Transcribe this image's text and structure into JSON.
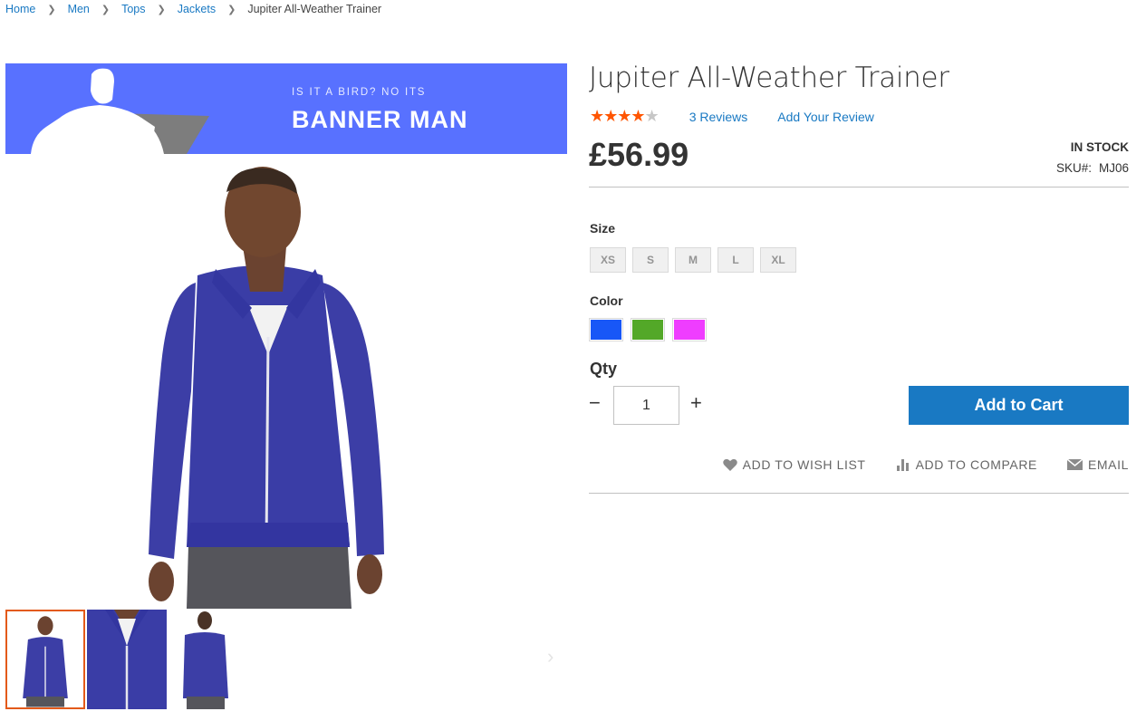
{
  "breadcrumb": {
    "items": [
      "Home",
      "Men",
      "Tops",
      "Jackets"
    ],
    "current": "Jupiter All-Weather Trainer"
  },
  "banner": {
    "tagline": "IS IT A BIRD? NO ITS",
    "headline": "BANNER MAN",
    "color": "#5871ff"
  },
  "product": {
    "title": "Jupiter All-Weather Trainer",
    "rating_stars": 4,
    "rating_max": 5,
    "reviews_link": "3  Reviews",
    "add_review_link": "Add Your Review",
    "price": "£56.99",
    "stock": "IN STOCK",
    "sku_label": "SKU#:",
    "sku": "MJ06"
  },
  "options": {
    "size_label": "Size",
    "sizes": [
      "XS",
      "S",
      "M",
      "L",
      "XL"
    ],
    "color_label": "Color",
    "colors": [
      "#1857f7",
      "#53a828",
      "#ef3dff"
    ]
  },
  "purchase": {
    "qty_label": "Qty",
    "qty_value": "1",
    "minus": "−",
    "plus": "+",
    "add_to_cart": "Add to Cart"
  },
  "actions": {
    "wishlist": "ADD TO WISH LIST",
    "compare": "ADD TO COMPARE",
    "email": "EMAIL"
  },
  "gallery": {
    "next_arrow": "›"
  }
}
